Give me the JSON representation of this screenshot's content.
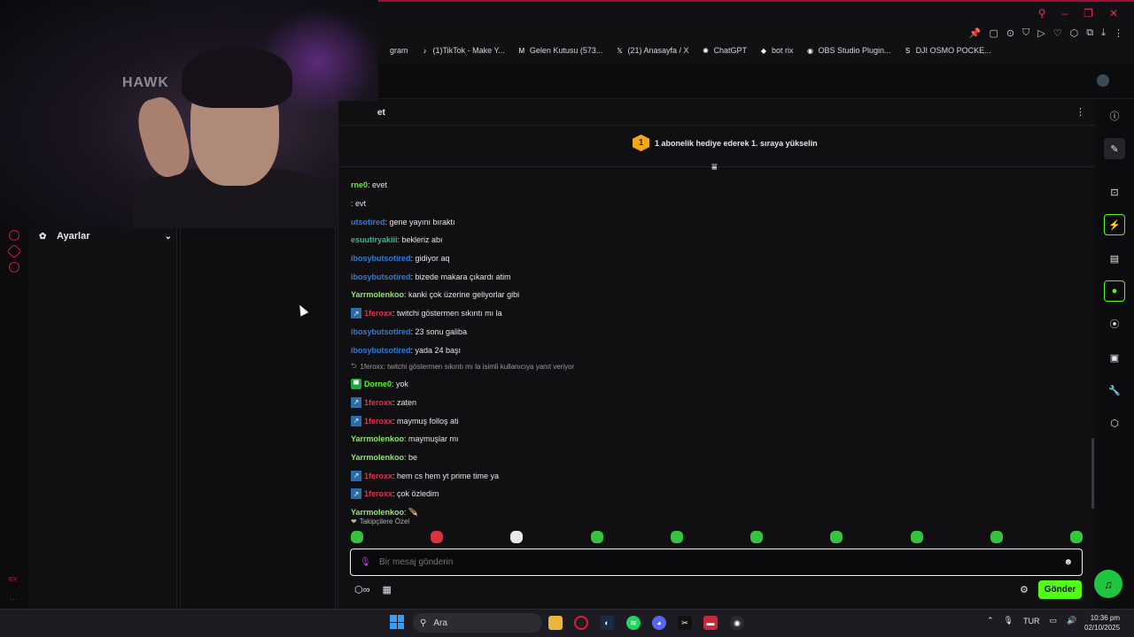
{
  "browser": {
    "window_controls": [
      "⚲",
      "–",
      "❐",
      "✕"
    ],
    "extension_icons": [
      "📌",
      "▢",
      "⊙",
      "⛉",
      "▷",
      "♡",
      "⬡",
      "⧉",
      "⤓",
      "⋮"
    ],
    "bookmarks": [
      {
        "icon": "instagram-icon",
        "glyph": "",
        "label": "gram"
      },
      {
        "icon": "tiktok-icon",
        "glyph": "♪",
        "label": "(1)TikTok - Make Y..."
      },
      {
        "icon": "gmail-icon",
        "glyph": "M",
        "label": "Gelen Kutusu (573..."
      },
      {
        "icon": "x-icon",
        "glyph": "𝕏",
        "label": "(21) Anasayfa / X"
      },
      {
        "icon": "chatgpt-icon",
        "glyph": "✺",
        "label": "ChatGPT"
      },
      {
        "icon": "bot-icon",
        "glyph": "◆",
        "label": "bot rix"
      },
      {
        "icon": "obs-icon",
        "glyph": "◉",
        "label": "OBS Studio Plugin..."
      },
      {
        "icon": "s-icon",
        "glyph": "S",
        "label": "DJI OSMO POCKE..."
      }
    ]
  },
  "webcam": {
    "logo_text": "HAWK"
  },
  "sidebar": {
    "settings_label": "Ayarlar",
    "rail_text": "EX",
    "rail_more": "···"
  },
  "chat": {
    "title": "et",
    "gift_badge_number": "1",
    "gift_text": "1 abonelik hediye ederek 1. sıraya yükselin",
    "messages": [
      {
        "type": "msg",
        "user": "rne0",
        "user_color": "#53fc18",
        "text": ": evet",
        "badge": ""
      },
      {
        "type": "msg",
        "user": "",
        "user_color": "#53fc18",
        "text": ": evt",
        "badge": ""
      },
      {
        "type": "msg",
        "user": "utsotired",
        "user_color": "#2f7bd9",
        "text": ": gene yayını bıraktı",
        "badge": ""
      },
      {
        "type": "msg",
        "user": "esuutiryakiii",
        "user_color": "#2fbf8f",
        "text": ": bekleriz abı",
        "badge": ""
      },
      {
        "type": "msg",
        "user": "ibosybutsotired",
        "user_color": "#2f7bd9",
        "text": ": gidiyor aq",
        "badge": ""
      },
      {
        "type": "msg",
        "user": "ibosybutsotired",
        "user_color": "#2f7bd9",
        "text": ": bizede makara çıkardı atim",
        "badge": ""
      },
      {
        "type": "msg",
        "user": "Yarrmolenkoo",
        "user_color": "#8fe96a",
        "text": ": kanki çok üzerine geliyorlar gibi",
        "badge": ""
      },
      {
        "type": "msg",
        "user": "1feroxx",
        "user_color": "#e2304e",
        "text": ": twitchi göstermen sıkıntı mı la",
        "badge": "blue"
      },
      {
        "type": "msg",
        "user": "ibosybutsotired",
        "user_color": "#2f7bd9",
        "text": ": 23 sonu galiba",
        "badge": ""
      },
      {
        "type": "msg",
        "user": "ibosybutsotired",
        "user_color": "#2f7bd9",
        "text": ": yada 24 başı",
        "badge": ""
      },
      {
        "type": "reply",
        "user": "1feroxx",
        "user_color": "#9a9aa2",
        "text": "1feroxx: twitchi göstermen sıkıntı mı la isimli kullanıcıya yanıt veriyor",
        "badge": ""
      },
      {
        "type": "msg",
        "user": "Dorne0",
        "user_color": "#53fc18",
        "text": ": yok",
        "badge": "green"
      },
      {
        "type": "msg",
        "user": "1feroxx",
        "user_color": "#e2304e",
        "text": ": zaten",
        "badge": "blue"
      },
      {
        "type": "msg",
        "user": "1feroxx",
        "user_color": "#e2304e",
        "text": ": maymuş folloş ati",
        "badge": "blue"
      },
      {
        "type": "msg",
        "user": "Yarrmolenkoo",
        "user_color": "#8fe96a",
        "text": ": maymuşlar mı",
        "badge": ""
      },
      {
        "type": "msg",
        "user": "Yarrmolenkoo",
        "user_color": "#8fe96a",
        "text": ": be",
        "badge": ""
      },
      {
        "type": "msg",
        "user": "1feroxx",
        "user_color": "#e2304e",
        "text": ": hem cs hem yt prime time ya",
        "badge": "blue"
      },
      {
        "type": "msg",
        "user": "1feroxx",
        "user_color": "#e2304e",
        "text": ": çok özledim",
        "badge": "blue"
      },
      {
        "type": "msg",
        "user": "Yarrmolenkoo",
        "user_color": "#8fe96a",
        "text": ": ",
        "badge": "",
        "emote": true
      }
    ],
    "followers_only_label": "Takipçilere Özel",
    "emote_count": 10,
    "input_placeholder": "Bir mesaj gönderin",
    "infinity_label": "∞",
    "send_label": "Gönder"
  },
  "taskbar": {
    "search_label": "Ara",
    "language": "TUR",
    "time": "10:36 pm",
    "date": "02/10/2025",
    "apps": [
      "explorer",
      "opera-gx",
      "steam",
      "spotify",
      "discord",
      "capcut",
      "media-player",
      "obs"
    ]
  },
  "colors": {
    "accent": "#53fc18",
    "brand_red": "#c2193f"
  }
}
